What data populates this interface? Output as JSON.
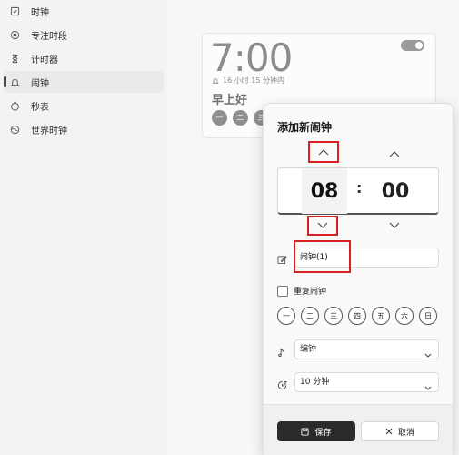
{
  "sidebar": {
    "items": [
      {
        "label": "时钟",
        "icon": "clock-icon",
        "active": false
      },
      {
        "label": "专注时段",
        "icon": "focus-icon",
        "active": false
      },
      {
        "label": "计时器",
        "icon": "hourglass-icon",
        "active": false
      },
      {
        "label": "闹钟",
        "icon": "bell-icon",
        "active": true
      },
      {
        "label": "秒表",
        "icon": "stopwatch-icon",
        "active": false
      },
      {
        "label": "世界时钟",
        "icon": "globe-icon",
        "active": false
      }
    ]
  },
  "alarm_card": {
    "time": "7:00",
    "remaining": "16 小时 15 分钟内",
    "name": "早上好",
    "days": [
      "一",
      "二",
      "三"
    ]
  },
  "dialog": {
    "title": "添加新闹钟",
    "hour": "08",
    "separator": ":",
    "minute": "00",
    "name_value": "闹钟(1)",
    "repeat_label": "重复闹钟",
    "days": [
      "一",
      "二",
      "三",
      "四",
      "五",
      "六",
      "日"
    ],
    "sound_value": "编钟",
    "snooze_value": "10 分钟",
    "save_label": "保存",
    "cancel_label": "取消"
  },
  "colors": {
    "highlight": "#d92020",
    "save_button": "#2b2b2b"
  }
}
